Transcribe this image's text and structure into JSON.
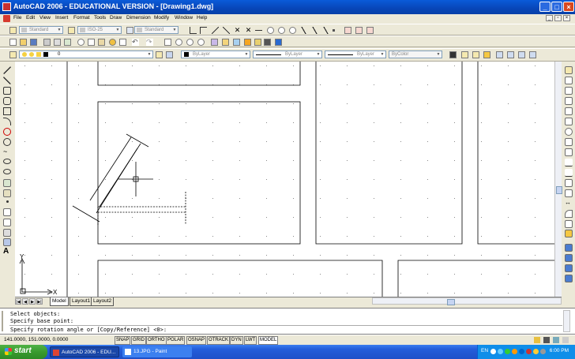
{
  "window": {
    "title": "AutoCAD 2006 - EDUCATIONAL VERSION - [Drawing1.dwg]"
  },
  "menu": [
    "File",
    "Edit",
    "View",
    "Insert",
    "Format",
    "Tools",
    "Draw",
    "Dimension",
    "Modify",
    "Window",
    "Help"
  ],
  "styles": {
    "text_style": "Standard",
    "dim_style": "ISO-25",
    "table_style": "Standard"
  },
  "layers": {
    "current_layer": "0",
    "color": "ByLayer",
    "linetype": "ByLayer",
    "lineweight": "ByLayer",
    "plotstyle": "ByColor"
  },
  "layout_tabs": [
    "Model",
    "Layout1",
    "Layout2"
  ],
  "ucs": {
    "x_label": "X",
    "y_label": "Y"
  },
  "command": {
    "lines": [
      "Select objects:",
      "Specify base point:"
    ],
    "prompt": "Specify rotation angle or [Copy/Reference] <0>:"
  },
  "status": {
    "coords": "141.0000, 151.0000, 0.0000",
    "toggles": [
      "SNAP",
      "GRID",
      "ORTHO",
      "POLAR",
      "OSNAP",
      "OTRACK",
      "DYN",
      "LWT",
      "MODEL"
    ]
  },
  "taskbar": {
    "start": "start",
    "tasks": [
      "AutoCAD 2006 - EDU...",
      "13.JPG - Paint"
    ],
    "lang": "EN",
    "clock": "6:00 PM"
  },
  "colors": {
    "titlebar": "#0846b8",
    "taskbar": "#245edb",
    "start": "#3a9b2f"
  }
}
